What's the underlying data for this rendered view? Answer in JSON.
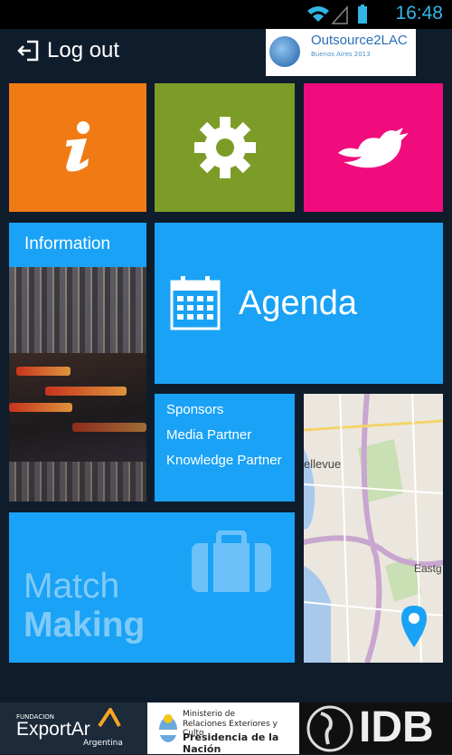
{
  "status_bar": {
    "time": "16:48"
  },
  "header": {
    "logout_label": "Log out",
    "brand_logo": "Outsource2LAC",
    "brand_sub": "Buenos Aires 2013"
  },
  "tiles": {
    "info_icon": "info-icon",
    "settings_icon": "gear-icon",
    "twitter_icon": "twitter-bird-icon",
    "information_label": "Information",
    "agenda_label": "Agenda",
    "sponsors": [
      "Sponsors",
      "Media Partner",
      "Knowledge Partner"
    ],
    "match_making_line1": "Match",
    "match_making_line2": "Making"
  },
  "map": {
    "label_bellevue": "ellevue",
    "label_eastgate": "Eastg"
  },
  "footer": {
    "exportar_small": "FUNDACION",
    "exportar_name": "ExportAr",
    "exportar_country": "Argentina",
    "ministerio_line1": "Ministerio de",
    "ministerio_line2": "Relaciones Exteriores y Culto",
    "ministerio_line3": "Presidencia de la Nación",
    "idb_name": "IDB"
  },
  "colors": {
    "orange": "#f07b15",
    "olive": "#7d9c27",
    "magenta": "#f00c7d",
    "blue": "#19a2f6",
    "background": "#0f1c2b"
  }
}
